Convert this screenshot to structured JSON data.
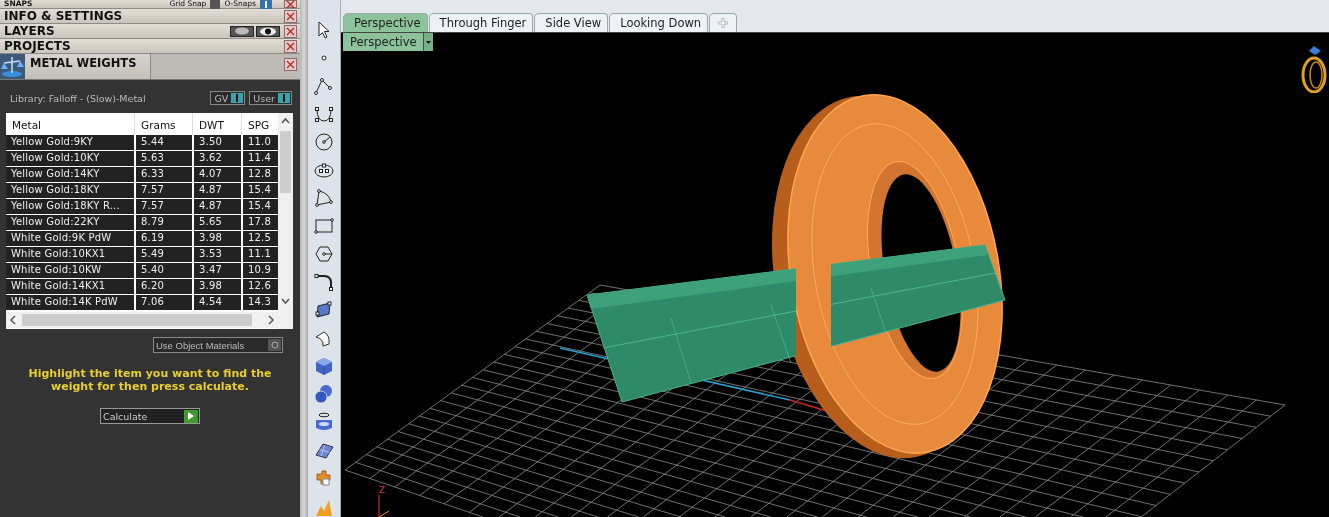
{
  "panels": [
    {
      "kind": "snaps",
      "label": "SNAPS",
      "grid_snap": {
        "label": "Grid Snap",
        "checked": true
      },
      "osnaps": {
        "label": "O-Snaps",
        "on": true
      }
    },
    {
      "kind": "plain",
      "label": "INFO & SETTINGS"
    },
    {
      "kind": "layers",
      "label": "LAYERS"
    },
    {
      "kind": "plain",
      "label": "PROJECTS"
    }
  ],
  "metal_weights": {
    "title": "METAL WEIGHTS",
    "library": "Library: Falloff - (Slow)-Metal",
    "toggles": [
      {
        "label": "GV",
        "on": true
      },
      {
        "label": "User",
        "on": true
      }
    ],
    "table": {
      "columns": [
        "Metal",
        "Grams",
        "DWT",
        "SPG"
      ],
      "rows": [
        {
          "selected": false,
          "cells": [
            "Yellow Gold:9KY",
            "5.44",
            "3.50",
            "11.0"
          ]
        },
        {
          "selected": false,
          "cells": [
            "Yellow Gold:10KY",
            "5.63",
            "3.62",
            "11.4"
          ]
        },
        {
          "selected": false,
          "cells": [
            "Yellow Gold:14KY",
            "6.33",
            "4.07",
            "12.8"
          ]
        },
        {
          "selected": false,
          "cells": [
            "Yellow Gold:18KY",
            "7.57",
            "4.87",
            "15.4"
          ]
        },
        {
          "selected": false,
          "cells": [
            "Yellow Gold:18KY R...",
            "7.57",
            "4.87",
            "15.4"
          ]
        },
        {
          "selected": false,
          "cells": [
            "Yellow Gold:22KY",
            "8.79",
            "5.65",
            "17.8"
          ]
        },
        {
          "selected": false,
          "cells": [
            "White Gold:9K PdW",
            "6.19",
            "3.98",
            "12.5"
          ]
        },
        {
          "selected": false,
          "cells": [
            "White Gold:10KX1",
            "5.49",
            "3.53",
            "11.1"
          ]
        },
        {
          "selected": false,
          "cells": [
            "White Gold:10KW",
            "5.40",
            "3.47",
            "10.9"
          ]
        },
        {
          "selected": false,
          "cells": [
            "White Gold:14KX1",
            "6.20",
            "3.98",
            "12.6"
          ]
        },
        {
          "selected": false,
          "cells": [
            "White Gold:14K PdW",
            "7.06",
            "4.54",
            "14.3"
          ]
        }
      ]
    },
    "use_object_materials": {
      "label": "Use Object Materials",
      "on": false
    },
    "hint": "Highlight the item you want to find the weight for then press calculate.",
    "calculate_button": "Calculate"
  },
  "viewport": {
    "tabs": [
      {
        "label": "Perspective",
        "selected": true
      },
      {
        "label": "Through Finger",
        "selected": false
      },
      {
        "label": "Side View",
        "selected": false
      },
      {
        "label": "Looking Down",
        "selected": false
      }
    ],
    "view_dropdown": "Perspective",
    "axis_label": "Z"
  }
}
